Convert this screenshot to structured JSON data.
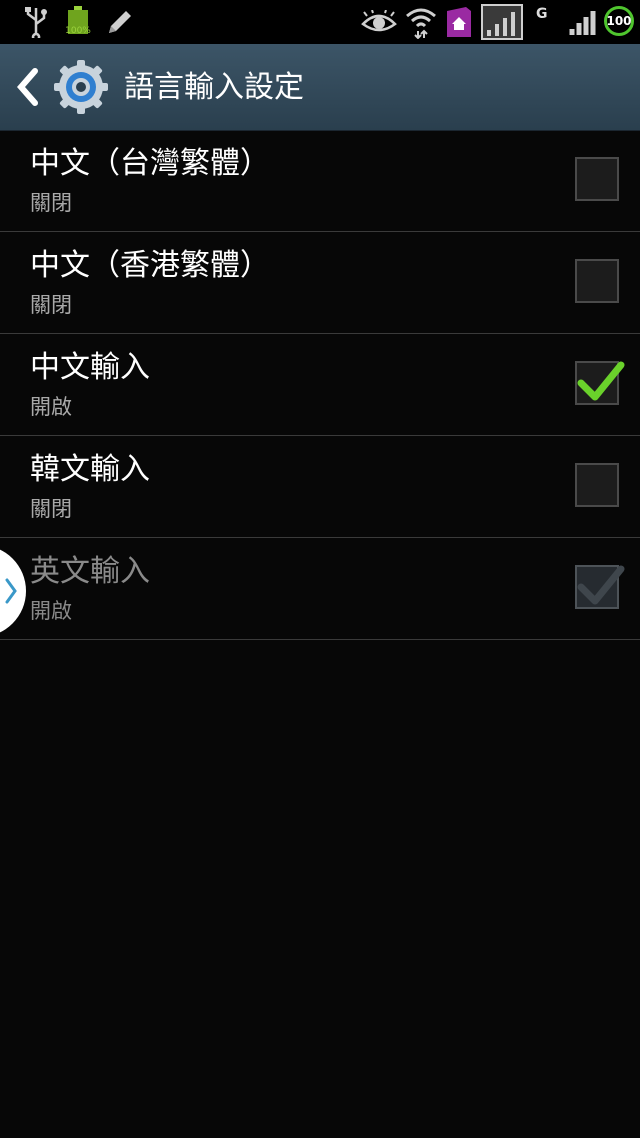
{
  "status_bar": {
    "battery_left_text": "100%",
    "network_type": "G",
    "battery_level": "100",
    "icons": [
      "usb-icon",
      "battery-icon",
      "pencil-icon",
      "eye-icon",
      "wifi-icon",
      "home-icon",
      "signal-box-icon",
      "signal-icon"
    ]
  },
  "action_bar": {
    "title": "語言輸入設定",
    "back_icon": "chevron-left-icon",
    "app_icon": "gear-icon"
  },
  "items": [
    {
      "label": "中文（台灣繁體）",
      "status": "關閉",
      "checked": false,
      "enabled": true
    },
    {
      "label": "中文（香港繁體）",
      "status": "關閉",
      "checked": false,
      "enabled": true
    },
    {
      "label": "中文輸入",
      "status": "開啟",
      "checked": true,
      "enabled": true
    },
    {
      "label": "韓文輸入",
      "status": "關閉",
      "checked": false,
      "enabled": true
    },
    {
      "label": "英文輸入",
      "status": "開啟",
      "checked": true,
      "enabled": false
    }
  ],
  "colors": {
    "accent_check": "#6ad12b",
    "action_bar": "#34495a",
    "background": "#070707"
  }
}
